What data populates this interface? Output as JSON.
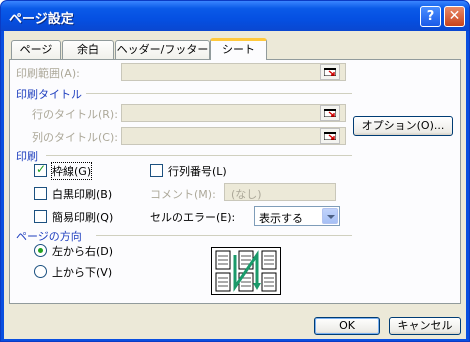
{
  "window": {
    "title": "ページ設定",
    "help_label": "?",
    "close_label": "✕"
  },
  "tabs": [
    {
      "label": "ページ"
    },
    {
      "label": "余白"
    },
    {
      "label": "ヘッダー/フッター"
    },
    {
      "label": "シート"
    }
  ],
  "print_area": {
    "label": "印刷範囲(A):",
    "value": ""
  },
  "print_titles": {
    "section_label": "印刷タイトル",
    "rows_label": "行のタイトル(R):",
    "cols_label": "列のタイトル(C):",
    "rows_value": "",
    "cols_value": ""
  },
  "options_button": "オプション(O)...",
  "print": {
    "section_label": "印刷",
    "gridlines_label": "枠線(G)",
    "gridlines_checked": true,
    "bw_label": "白黒印刷(B)",
    "bw_checked": false,
    "draft_label": "簡易印刷(Q)",
    "draft_checked": false,
    "headings_label": "行列番号(L)",
    "headings_checked": false,
    "comments_label": "コメント(M):",
    "comments_value": "(なし)",
    "errors_label": "セルのエラー(E):",
    "errors_value": "表示する"
  },
  "page_order": {
    "section_label": "ページの方向",
    "down_then_over_label": "左から右(D)",
    "over_then_down_label": "上から下(V)",
    "selected": "down_then_over"
  },
  "footer": {
    "ok_label": "OK",
    "cancel_label": "キャンセル"
  },
  "colors": {
    "title_bar": "#0a5ae8",
    "section_text": "#1f3fbf",
    "dialog_bg": "#ece9d8",
    "active_tab_accent": "#ffc83c"
  }
}
